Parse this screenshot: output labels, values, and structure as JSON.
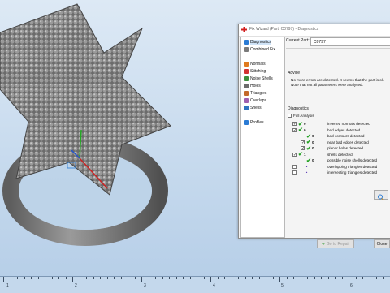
{
  "dialog": {
    "title": "Fix Wizard (Part: C0797) - Diagnostics",
    "close_glyph": "–",
    "nav": [
      {
        "label": "Diagnostics",
        "icon": "diagnostics-icon",
        "selected": true
      },
      {
        "label": "Combined Fix",
        "icon": "combined-fix-icon"
      },
      {
        "label": "Normals",
        "icon": "normals-icon"
      },
      {
        "label": "Stitching",
        "icon": "stitching-icon"
      },
      {
        "label": "Noise Shells",
        "icon": "noise-shells-icon"
      },
      {
        "label": "Holes",
        "icon": "holes-icon"
      },
      {
        "label": "Triangles",
        "icon": "triangles-icon"
      },
      {
        "label": "Overlaps",
        "icon": "overlaps-icon"
      },
      {
        "label": "Shells",
        "icon": "shells-icon"
      },
      {
        "label": "Profiles",
        "icon": "profiles-icon"
      }
    ],
    "current_part_label": "Current Part:",
    "current_part_value": "C0797",
    "advice_title": "Advice",
    "advice_text": "No more errors are detected. It seems that the part is ok. Note that not all parameters were analysed.",
    "diagnostics_title": "Diagnostics",
    "full_analysis_label": "Full Analysis",
    "items": [
      {
        "label": "inverted normals detected",
        "count": "0",
        "cb": true,
        "check": true
      },
      {
        "label": "bad edges detected",
        "count": "0",
        "cb": true,
        "check": true
      },
      {
        "label": "bad contours detected",
        "count": "0",
        "cb": false,
        "check": true,
        "indent": 1
      },
      {
        "label": "near bad edges detected",
        "count": "0",
        "cb": true,
        "check": true,
        "indent": 1
      },
      {
        "label": "planar holes detected",
        "count": "0",
        "cb": true,
        "check": true,
        "indent": 1
      },
      {
        "label": "shells detected",
        "count": "1",
        "cb": true,
        "check": true
      },
      {
        "label": "possible noise shells detected",
        "count": "0",
        "cb": false,
        "check": true,
        "indent": 1
      },
      {
        "label": "overlapping triangles detected",
        "count": "•",
        "cb": true,
        "check": false
      },
      {
        "label": "intersecting triangles detected",
        "count": "•",
        "cb": true,
        "check": false
      }
    ],
    "go_button": "Go to Repair",
    "close_button": "Close"
  },
  "ruler": {
    "labels": [
      "1",
      "2",
      "3",
      "4",
      "5",
      "6"
    ]
  },
  "colors": {
    "accent": "#2a7bd4",
    "check": "#20a020",
    "viewport": "#c8dbee"
  }
}
